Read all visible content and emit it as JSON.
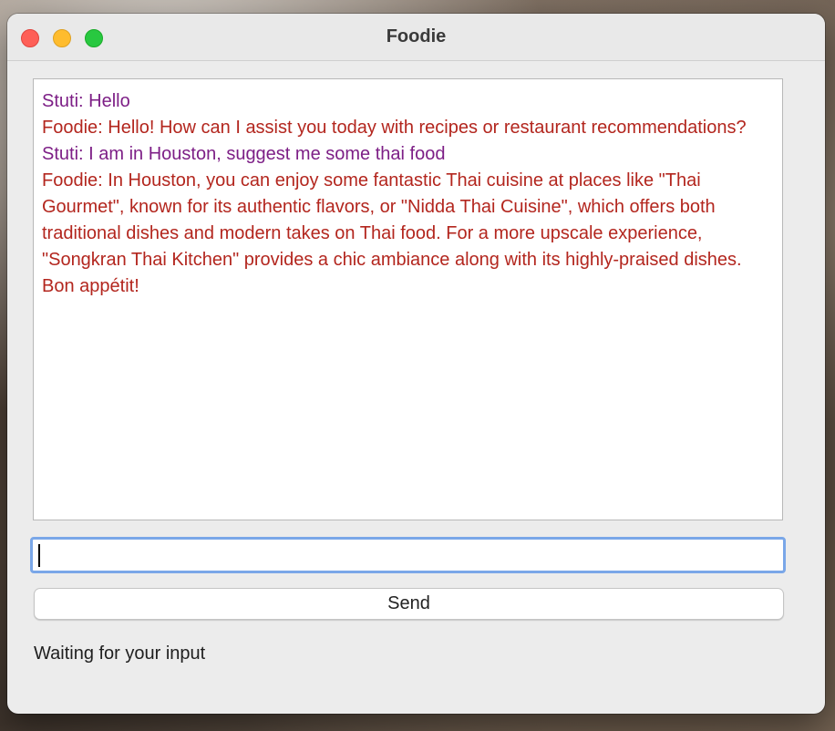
{
  "window": {
    "title": "Foodie"
  },
  "chat": {
    "messages": [
      {
        "role": "user",
        "text": "Stuti: Hello"
      },
      {
        "role": "bot",
        "text": "Foodie: Hello! How can I assist you today with recipes or restaurant recommendations?"
      },
      {
        "role": "user",
        "text": "Stuti: I am in Houston, suggest me some thai food"
      },
      {
        "role": "bot",
        "text": "Foodie: In Houston, you can enjoy some fantastic Thai cuisine at places like \"Thai Gourmet\", known for its authentic flavors, or \"Nidda Thai Cuisine\", which offers both traditional dishes and modern takes on Thai food. For a more upscale experience, \"Songkran Thai Kitchen\" provides a chic ambiance along with its highly-praised dishes. Bon appétit!"
      }
    ]
  },
  "input": {
    "value": ""
  },
  "send_button": {
    "label": "Send"
  },
  "status": {
    "text": "Waiting for your input"
  },
  "colors": {
    "user_message": "#7d1f86",
    "bot_message": "#b3261e",
    "focus_ring": "#7aa7e8"
  }
}
